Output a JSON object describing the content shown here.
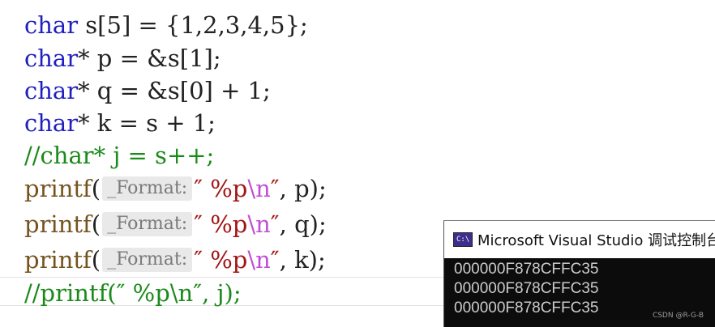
{
  "editor": {
    "lines": [
      {
        "kw": "char",
        "rest": " s[5] = {1,2,3,4,5};"
      },
      {
        "kw": "char",
        "rest": "* p = &s[1];"
      },
      {
        "kw": "char",
        "rest": "* q = &s[0] + 1;"
      },
      {
        "kw": "char",
        "rest": "* k = s + 1;"
      },
      {
        "comment": "//char* j = s++;"
      },
      {
        "fn": "printf",
        "open": "(",
        "hint": "_Format:",
        "str_open": "″ %p",
        "esc": "\\n",
        "str_close": "″",
        "rest": ", p);"
      },
      {
        "fn": "printf",
        "open": "(",
        "hint": "_Format:",
        "str_open": "″ %p",
        "esc": "\\n",
        "str_close": "″",
        "rest": ", q);"
      },
      {
        "fn": "printf",
        "open": "(",
        "hint": "_Format:",
        "str_open": "″ %p",
        "esc": "\\n",
        "str_close": "″",
        "rest": ", k);"
      },
      {
        "comment": "//printf(″ %p\\n″, j);"
      }
    ]
  },
  "console": {
    "icon": "console-app-icon",
    "icon_text": "C:\\",
    "title": "Microsoft Visual Studio 调试控制台",
    "output": [
      "000000F878CFFC35",
      "000000F878CFFC35",
      "000000F878CFFC35"
    ]
  },
  "watermark": "CSDN @R-G-B",
  "colors": {
    "keyword": "#1f1fbf",
    "function": "#74531f",
    "string": "#a31515",
    "escape": "#c04fd8",
    "comment": "#1a8a1a",
    "console_bg": "#0c0c0c"
  }
}
